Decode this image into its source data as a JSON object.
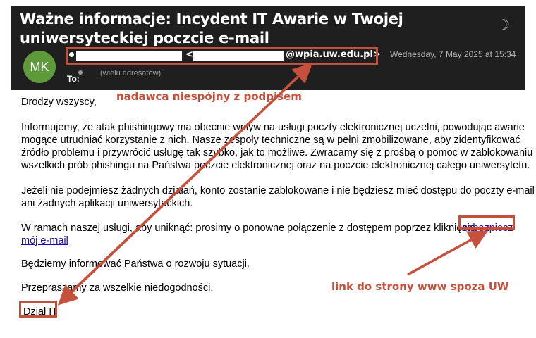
{
  "email": {
    "subject": "Ważne informacje: Incydent IT Awarie w Twojej uniwersyteckiej poczcie e-mail",
    "avatar_initials": "MK",
    "sender_separator": "<",
    "sender_domain": "@wpia.uw.edu.pl>",
    "date": "Wednesday, 7 May 2025 at 15:34",
    "to_label": "To:",
    "to_value": "(wielu adresatów)"
  },
  "body": {
    "greeting": "Drodzy wszyscy,",
    "p1": [
      "Informujemy, że atak phishingowy ma obecnie wpływ na usługi poczty elektronicznej uczelni, powodując awarie",
      "mogące utrudniać korzystanie z nich. Nasze zespoły techniczne są w pełni zmobilizowane, aby zidentyfikować",
      "źródło problemu i przywrócić usługę tak szybko, jak to możliwe. Zwracamy się z prośbą o pomoc w zablokowaniu",
      "wszelkich prób phishingu na Państwa poczcie elektronicznej oraz na poczcie elektronicznej całego uniwersytetu."
    ],
    "p2": [
      "Jeżeli nie podejmiesz żadnych działań, konto zostanie zablokowane i nie będziesz mieć dostępu do poczty e-mail",
      "ani żadnych aplikacji uniwersyteckich."
    ],
    "p3_text": "W ramach naszej usługi, aby uniknąć: prosimy o ponowne połączenie z dostępem poprzez kliknięcie",
    "p3_link_line1": "zabezpiecz",
    "p3_link_line2": "mój e-mail",
    "p4": "Będziemy informować Państwa o rozwoju sytuacji.",
    "p5": "Przepraszamy za wszelkie niedogodności.",
    "signature": "Dział IT"
  },
  "annotations": {
    "sender_note": "nadawca niespójny z podpisem",
    "link_note": "link do strony www spoza UW",
    "color": "#c5503c"
  }
}
